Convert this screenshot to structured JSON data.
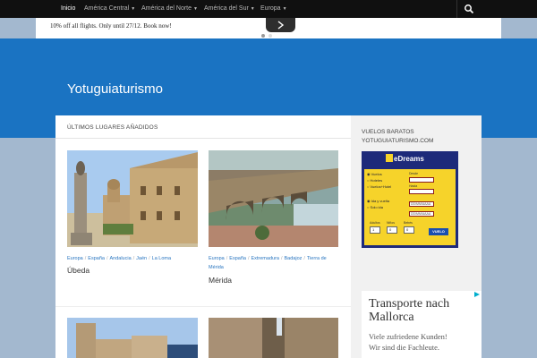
{
  "nav": {
    "items": [
      {
        "label": "Inicio",
        "caret": ""
      },
      {
        "label": "América Central",
        "caret": "▼"
      },
      {
        "label": "América del Norte",
        "caret": "▼"
      },
      {
        "label": "América del Sur",
        "caret": "▼"
      },
      {
        "label": "Europa",
        "caret": "▼"
      }
    ]
  },
  "promo": {
    "text": "10% off all flights. Only until 27/12. Book now!"
  },
  "site": {
    "title": "Yotuguiaturismo"
  },
  "main": {
    "section_title": "Últimos lugares añadidos",
    "posts": [
      {
        "cats": [
          "Europa",
          "España",
          "Andalucia",
          "Jaén",
          "La Loma"
        ],
        "title": "Úbeda"
      },
      {
        "cats": [
          "Europa",
          "España",
          "Extremadura",
          "Badajoz",
          "Tierra de Mérida"
        ],
        "title": "Mérida"
      }
    ]
  },
  "sidebar": {
    "widget_title": "Vuelos baratos yotuguiaturismo.com",
    "edreams": {
      "brand": "eDreams",
      "options": [
        "Vuelos",
        "Hoteles",
        "Vuelos+Hotel"
      ],
      "trip": [
        "Ida y vuelta",
        "Solo ida"
      ],
      "origin_label": "Desde",
      "dest_label": "Hasta",
      "date_placeholder": "DD/MM/AAAA",
      "pax_labels": [
        "Adultos",
        "Niños",
        "Bebés"
      ],
      "pax_values": [
        "1",
        "0",
        "0"
      ],
      "button": "VUELO"
    },
    "ad": {
      "line1": "Transporte nach",
      "line2": "Mallorca",
      "line3": "Viele zufriedene Kunden!",
      "line4": "Wir sind die Fachleute."
    }
  },
  "colors": {
    "header_blue": "#1a73c2",
    "link_blue": "#2a76c0",
    "nav_bg": "#101010",
    "page_bg": "#a3b8cf"
  }
}
